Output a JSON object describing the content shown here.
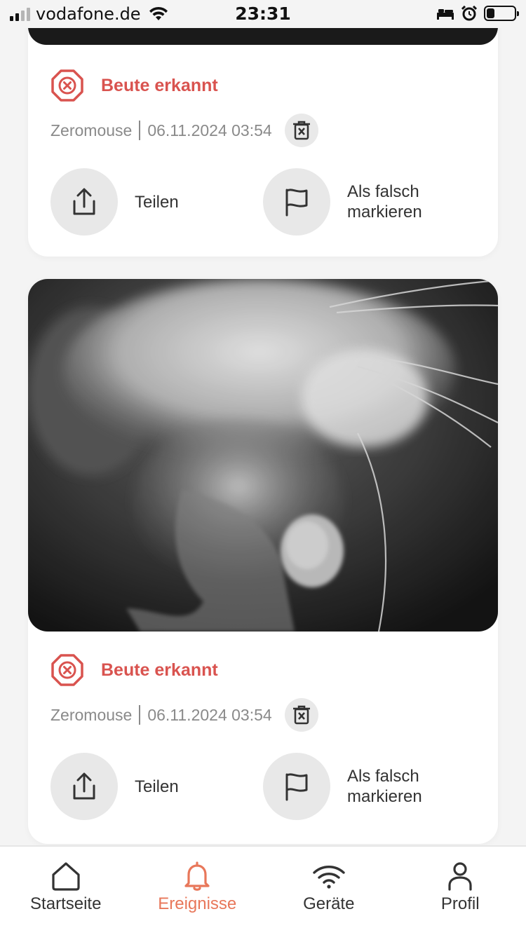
{
  "status_bar": {
    "carrier": "vodafone.de",
    "time": "23:31",
    "battery_level": 0.3
  },
  "events": [
    {
      "title": "Beute erkannt",
      "device": "Zeromouse",
      "datetime": "06.11.2024 03:54",
      "share_label": "Teilen",
      "flag_label_line1": "Als falsch",
      "flag_label_line2": "markieren"
    },
    {
      "title": "Beute erkannt",
      "device": "Zeromouse",
      "datetime": "06.11.2024 03:54",
      "share_label": "Teilen",
      "flag_label_line1": "Als falsch",
      "flag_label_line2": "markieren"
    }
  ],
  "nav": {
    "items": [
      {
        "label": "Startseite",
        "icon": "home-icon"
      },
      {
        "label": "Ereignisse",
        "icon": "bell-icon"
      },
      {
        "label": "Geräte",
        "icon": "wifi-icon"
      },
      {
        "label": "Profil",
        "icon": "person-icon"
      }
    ],
    "active": "Ereignisse"
  },
  "colors": {
    "accent": "#e8775a",
    "alert": "#d9534f",
    "meta_text": "#8a8a8a",
    "card_bg": "#ffffff",
    "page_bg": "#f4f4f4"
  }
}
